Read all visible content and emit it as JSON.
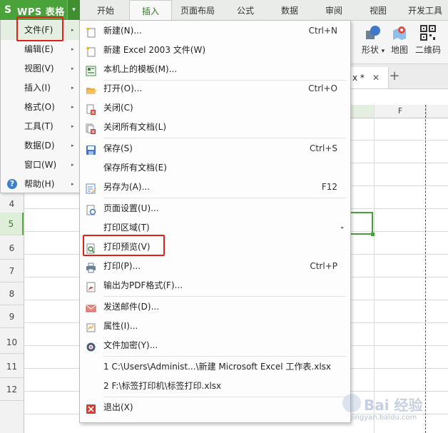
{
  "app": {
    "title": "WPS 表格",
    "logo_glyph": "S",
    "menu_arrow": "▾"
  },
  "ribbon_tabs": [
    "开始",
    "插入",
    "页面布局",
    "公式",
    "数据",
    "审阅",
    "视图",
    "开发工具"
  ],
  "ribbon_active_tab": "插入",
  "ribbon_buttons": {
    "shape_label": "形状",
    "shape_arrow": "▾",
    "map_label": "地图",
    "qrcode_label": "二维码"
  },
  "doc_tab": {
    "name": "x *",
    "close_glyph": "✕",
    "add_glyph": "+"
  },
  "grid": {
    "col_f": "F",
    "rows": [
      "4",
      "5",
      "6",
      "7",
      "8",
      "9",
      "10",
      "11",
      "12"
    ],
    "selected_row": "5"
  },
  "left_menu": {
    "items": [
      {
        "label": "文件(F)"
      },
      {
        "label": "编辑(E)"
      },
      {
        "label": "视图(V)"
      },
      {
        "label": "插入(I)"
      },
      {
        "label": "格式(O)"
      },
      {
        "label": "工具(T)"
      },
      {
        "label": "数据(D)"
      },
      {
        "label": "窗口(W)"
      },
      {
        "label": "帮助(H)"
      }
    ],
    "submenu_glyph": "▸",
    "help_glyph": "?"
  },
  "file_menu": {
    "items": [
      {
        "label": "新建(N)...",
        "shortcut": "Ctrl+N"
      },
      {
        "label": "新建 Excel 2003 文件(W)",
        "shortcut": ""
      },
      {
        "label": "本机上的模板(M)...",
        "shortcut": ""
      },
      {
        "label": "打开(O)...",
        "shortcut": "Ctrl+O"
      },
      {
        "label": "关闭(C)",
        "shortcut": ""
      },
      {
        "label": "关闭所有文档(L)",
        "shortcut": ""
      },
      {
        "label": "保存(S)",
        "shortcut": "Ctrl+S"
      },
      {
        "label": "保存所有文档(E)",
        "shortcut": ""
      },
      {
        "label": "另存为(A)...",
        "shortcut": "F12"
      },
      {
        "label": "页面设置(U)...",
        "shortcut": ""
      },
      {
        "label": "打印区域(T)",
        "shortcut": ""
      },
      {
        "label": "打印预览(V)",
        "shortcut": ""
      },
      {
        "label": "打印(P)...",
        "shortcut": "Ctrl+P"
      },
      {
        "label": "输出为PDF格式(F)...",
        "shortcut": ""
      },
      {
        "label": "发送邮件(D)...",
        "shortcut": ""
      },
      {
        "label": "属性(I)...",
        "shortcut": ""
      },
      {
        "label": "文件加密(Y)...",
        "shortcut": ""
      },
      {
        "label": "1 C:\\Users\\Administ...\\新建 Microsoft Excel 工作表.xlsx",
        "shortcut": ""
      },
      {
        "label": "2 F:\\标签打印机\\标签打印.xlsx",
        "shortcut": ""
      },
      {
        "label": "退出(X)",
        "shortcut": ""
      }
    ],
    "submenu_glyph": "▸"
  },
  "watermark": {
    "text": "Bai 经验",
    "sub": "jingyan.baidu.com"
  },
  "colors": {
    "brand_green": "#4aa23a",
    "highlight_red": "#e0201b",
    "selection_green": "#4a9e3a"
  }
}
